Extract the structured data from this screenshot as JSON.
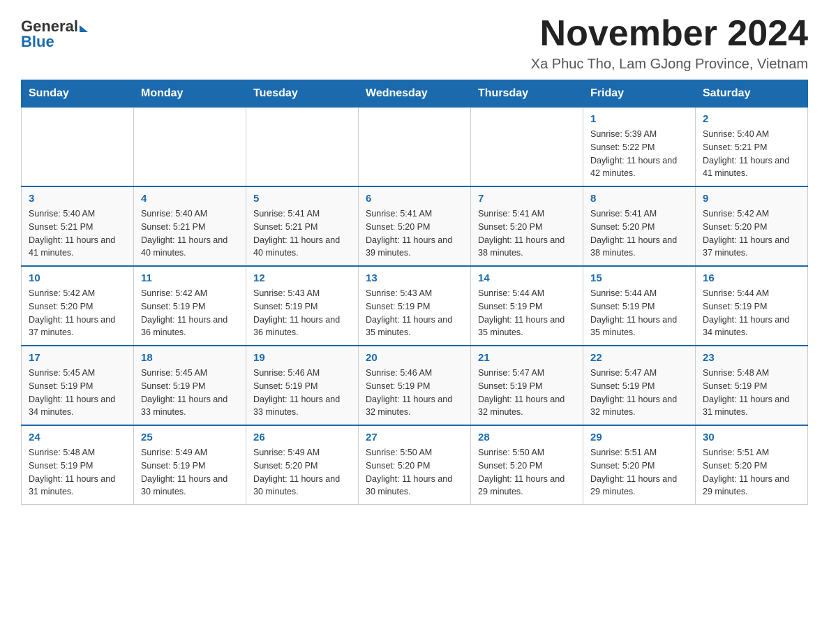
{
  "header": {
    "logo_general": "General",
    "logo_blue": "Blue",
    "month_title": "November 2024",
    "location": "Xa Phuc Tho, Lam GJong Province, Vietnam"
  },
  "weekdays": [
    "Sunday",
    "Monday",
    "Tuesday",
    "Wednesday",
    "Thursday",
    "Friday",
    "Saturday"
  ],
  "weeks": [
    [
      {
        "day": "",
        "info": ""
      },
      {
        "day": "",
        "info": ""
      },
      {
        "day": "",
        "info": ""
      },
      {
        "day": "",
        "info": ""
      },
      {
        "day": "",
        "info": ""
      },
      {
        "day": "1",
        "info": "Sunrise: 5:39 AM\nSunset: 5:22 PM\nDaylight: 11 hours and 42 minutes."
      },
      {
        "day": "2",
        "info": "Sunrise: 5:40 AM\nSunset: 5:21 PM\nDaylight: 11 hours and 41 minutes."
      }
    ],
    [
      {
        "day": "3",
        "info": "Sunrise: 5:40 AM\nSunset: 5:21 PM\nDaylight: 11 hours and 41 minutes."
      },
      {
        "day": "4",
        "info": "Sunrise: 5:40 AM\nSunset: 5:21 PM\nDaylight: 11 hours and 40 minutes."
      },
      {
        "day": "5",
        "info": "Sunrise: 5:41 AM\nSunset: 5:21 PM\nDaylight: 11 hours and 40 minutes."
      },
      {
        "day": "6",
        "info": "Sunrise: 5:41 AM\nSunset: 5:20 PM\nDaylight: 11 hours and 39 minutes."
      },
      {
        "day": "7",
        "info": "Sunrise: 5:41 AM\nSunset: 5:20 PM\nDaylight: 11 hours and 38 minutes."
      },
      {
        "day": "8",
        "info": "Sunrise: 5:41 AM\nSunset: 5:20 PM\nDaylight: 11 hours and 38 minutes."
      },
      {
        "day": "9",
        "info": "Sunrise: 5:42 AM\nSunset: 5:20 PM\nDaylight: 11 hours and 37 minutes."
      }
    ],
    [
      {
        "day": "10",
        "info": "Sunrise: 5:42 AM\nSunset: 5:20 PM\nDaylight: 11 hours and 37 minutes."
      },
      {
        "day": "11",
        "info": "Sunrise: 5:42 AM\nSunset: 5:19 PM\nDaylight: 11 hours and 36 minutes."
      },
      {
        "day": "12",
        "info": "Sunrise: 5:43 AM\nSunset: 5:19 PM\nDaylight: 11 hours and 36 minutes."
      },
      {
        "day": "13",
        "info": "Sunrise: 5:43 AM\nSunset: 5:19 PM\nDaylight: 11 hours and 35 minutes."
      },
      {
        "day": "14",
        "info": "Sunrise: 5:44 AM\nSunset: 5:19 PM\nDaylight: 11 hours and 35 minutes."
      },
      {
        "day": "15",
        "info": "Sunrise: 5:44 AM\nSunset: 5:19 PM\nDaylight: 11 hours and 35 minutes."
      },
      {
        "day": "16",
        "info": "Sunrise: 5:44 AM\nSunset: 5:19 PM\nDaylight: 11 hours and 34 minutes."
      }
    ],
    [
      {
        "day": "17",
        "info": "Sunrise: 5:45 AM\nSunset: 5:19 PM\nDaylight: 11 hours and 34 minutes."
      },
      {
        "day": "18",
        "info": "Sunrise: 5:45 AM\nSunset: 5:19 PM\nDaylight: 11 hours and 33 minutes."
      },
      {
        "day": "19",
        "info": "Sunrise: 5:46 AM\nSunset: 5:19 PM\nDaylight: 11 hours and 33 minutes."
      },
      {
        "day": "20",
        "info": "Sunrise: 5:46 AM\nSunset: 5:19 PM\nDaylight: 11 hours and 32 minutes."
      },
      {
        "day": "21",
        "info": "Sunrise: 5:47 AM\nSunset: 5:19 PM\nDaylight: 11 hours and 32 minutes."
      },
      {
        "day": "22",
        "info": "Sunrise: 5:47 AM\nSunset: 5:19 PM\nDaylight: 11 hours and 32 minutes."
      },
      {
        "day": "23",
        "info": "Sunrise: 5:48 AM\nSunset: 5:19 PM\nDaylight: 11 hours and 31 minutes."
      }
    ],
    [
      {
        "day": "24",
        "info": "Sunrise: 5:48 AM\nSunset: 5:19 PM\nDaylight: 11 hours and 31 minutes."
      },
      {
        "day": "25",
        "info": "Sunrise: 5:49 AM\nSunset: 5:19 PM\nDaylight: 11 hours and 30 minutes."
      },
      {
        "day": "26",
        "info": "Sunrise: 5:49 AM\nSunset: 5:20 PM\nDaylight: 11 hours and 30 minutes."
      },
      {
        "day": "27",
        "info": "Sunrise: 5:50 AM\nSunset: 5:20 PM\nDaylight: 11 hours and 30 minutes."
      },
      {
        "day": "28",
        "info": "Sunrise: 5:50 AM\nSunset: 5:20 PM\nDaylight: 11 hours and 29 minutes."
      },
      {
        "day": "29",
        "info": "Sunrise: 5:51 AM\nSunset: 5:20 PM\nDaylight: 11 hours and 29 minutes."
      },
      {
        "day": "30",
        "info": "Sunrise: 5:51 AM\nSunset: 5:20 PM\nDaylight: 11 hours and 29 minutes."
      }
    ]
  ]
}
